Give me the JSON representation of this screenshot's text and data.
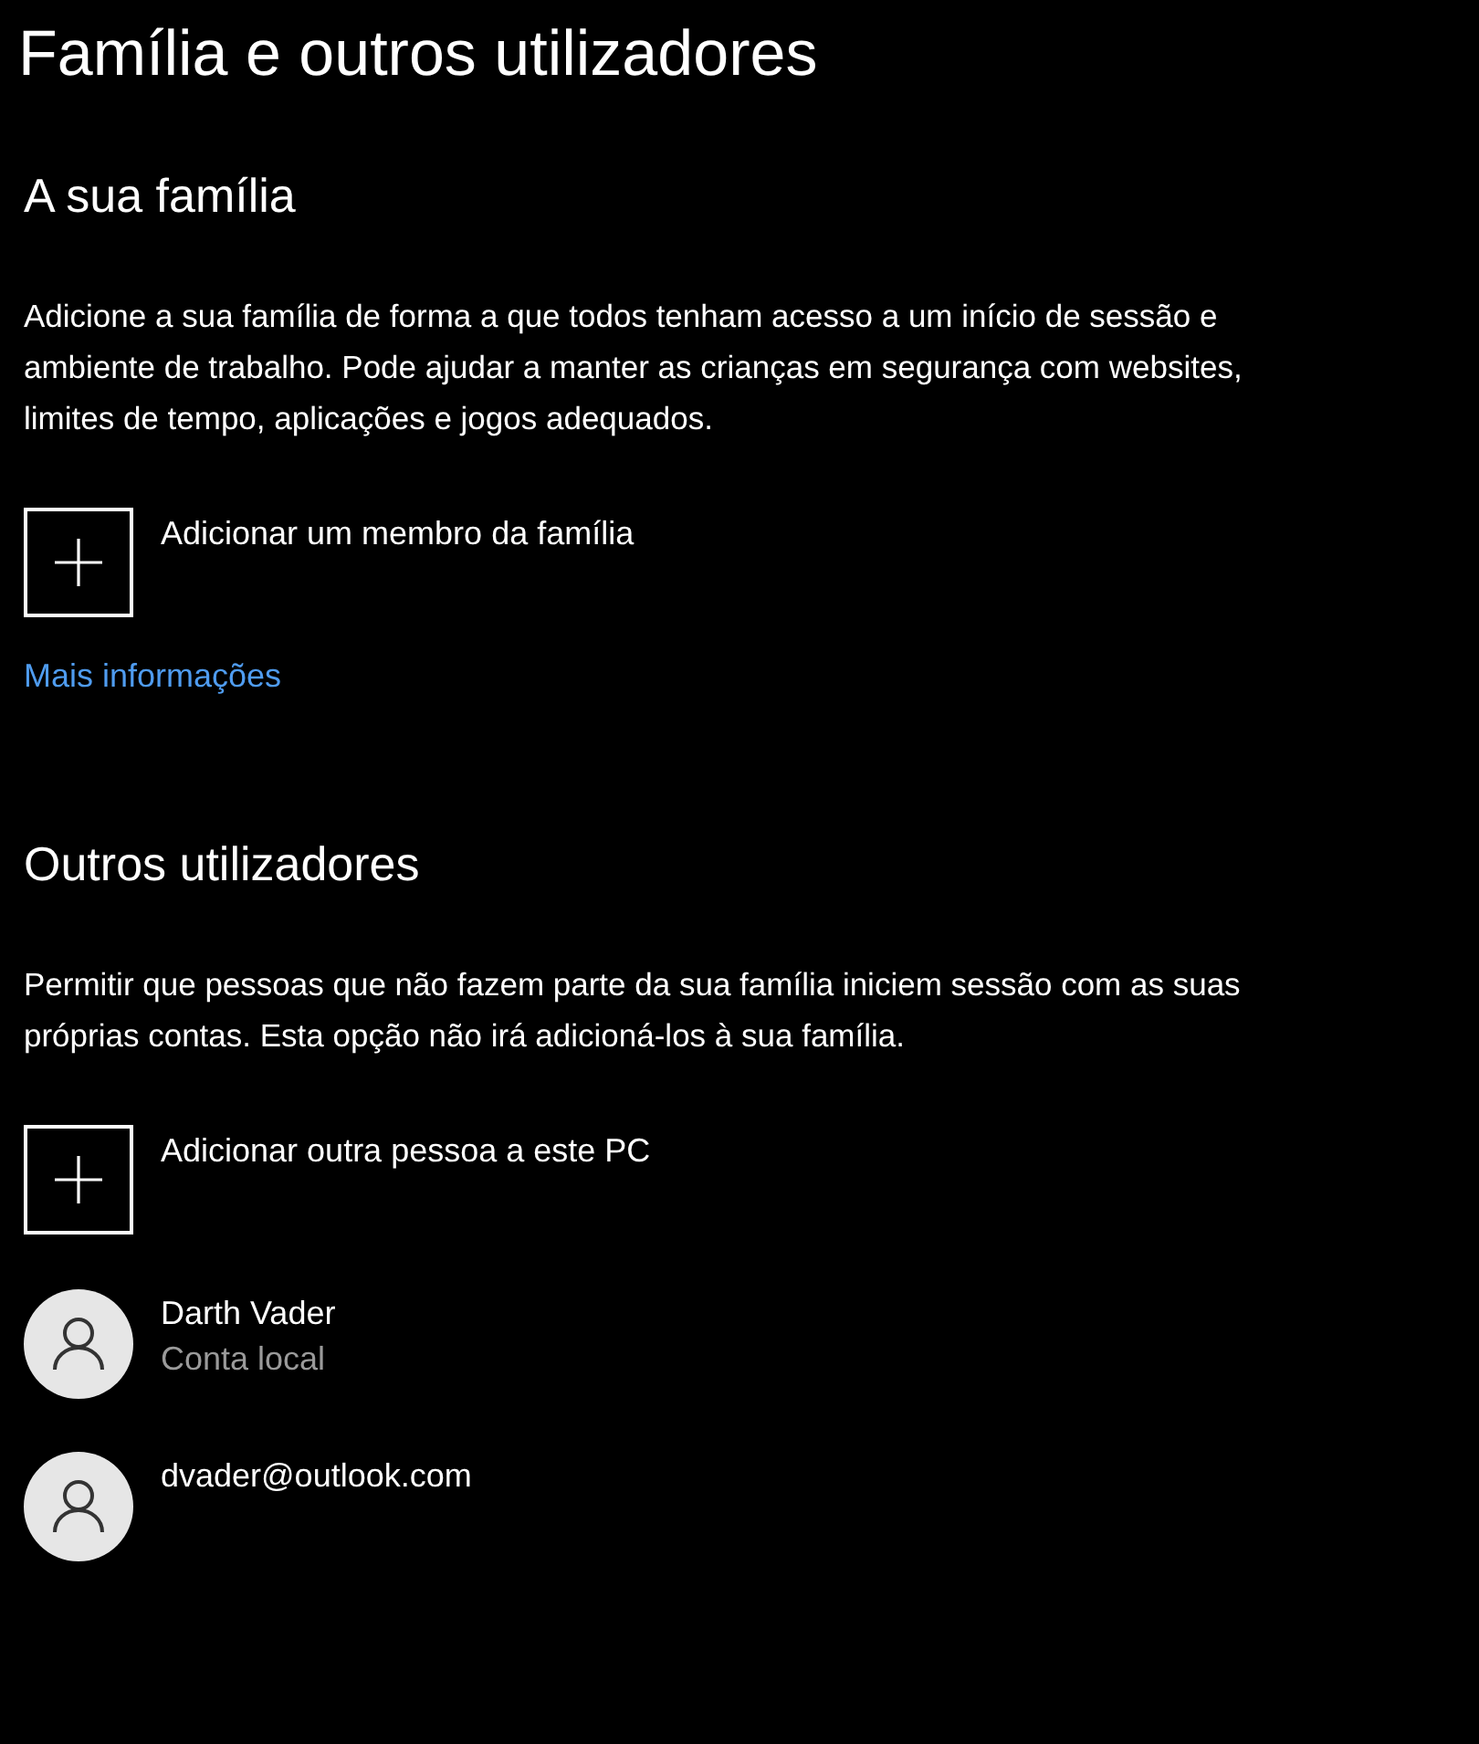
{
  "page_title": "Família e outros utilizadores",
  "sections": [
    {
      "heading": "A sua família",
      "description": "Adicione a sua família de forma a que todos tenham acesso a um início de sessão e ambiente de trabalho. Pode ajudar a manter as crianças em segurança com websites, limites de tempo, aplicações e jogos adequados.",
      "add_button": {
        "label": "Adicionar um membro da família"
      },
      "link": "Mais informações"
    },
    {
      "heading": "Outros utilizadores",
      "description": "Permitir que pessoas que não fazem parte da sua família iniciem sessão com as suas próprias contas. Esta opção não irá adicioná-los à sua família.",
      "add_button": {
        "label": "Adicionar outra pessoa a este PC"
      },
      "users": [
        {
          "name": "Darth Vader",
          "detail": "Conta local"
        },
        {
          "name": "dvader@outlook.com"
        }
      ]
    }
  ]
}
